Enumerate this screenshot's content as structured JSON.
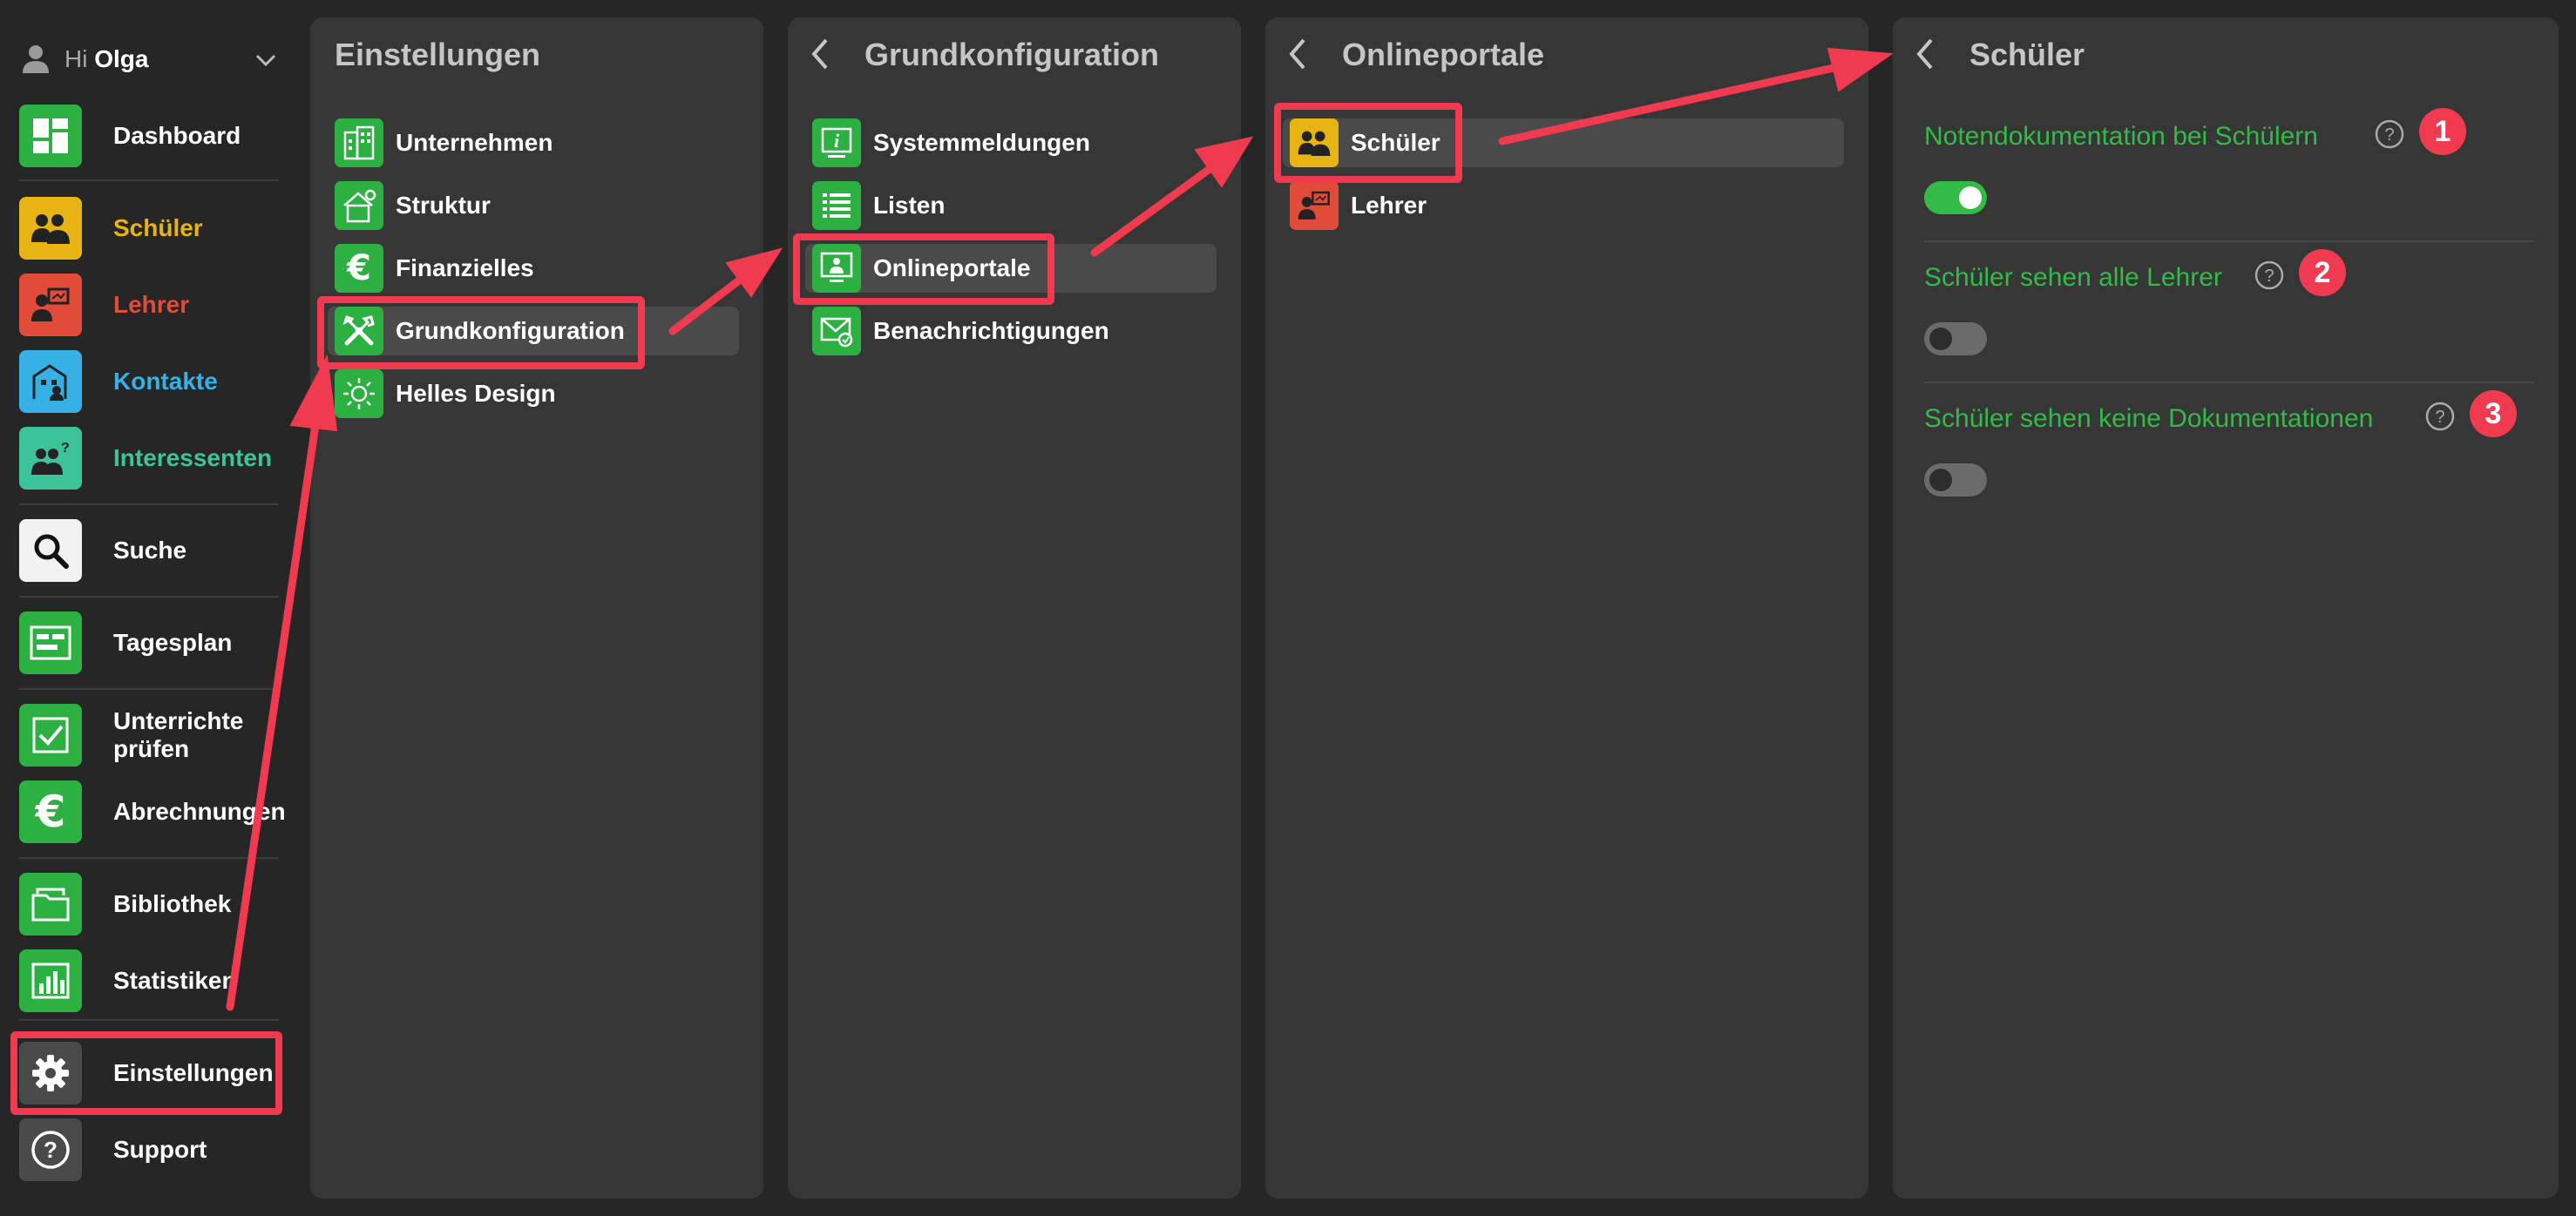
{
  "user": {
    "greeting": "Hi",
    "name": "Olga"
  },
  "sidebar": {
    "items": [
      {
        "label": "Dashboard",
        "color": "#ffffff",
        "icon": "dashboard-icon"
      },
      {
        "label": "Schüler",
        "color": "#e7b414",
        "icon": "students-icon"
      },
      {
        "label": "Lehrer",
        "color": "#e04b3a",
        "icon": "teacher-icon"
      },
      {
        "label": "Kontakte",
        "color": "#35b1e6",
        "icon": "contacts-icon"
      },
      {
        "label": "Interessenten",
        "color": "#3cc39a",
        "icon": "interested-icon"
      },
      {
        "label": "Suche",
        "color": "#ffffff",
        "icon": "search-icon"
      },
      {
        "label": "Tagesplan",
        "color": "#ffffff",
        "icon": "day-plan-icon"
      },
      {
        "label": "Unterrichte prüfen",
        "color": "#ffffff",
        "icon": "check-icon"
      },
      {
        "label": "Abrechnungen",
        "color": "#ffffff",
        "icon": "euro-icon"
      },
      {
        "label": "Bibliothek",
        "color": "#ffffff",
        "icon": "library-icon"
      },
      {
        "label": "Statistiken",
        "color": "#ffffff",
        "icon": "statistics-icon"
      },
      {
        "label": "Einstellungen",
        "color": "#ffffff",
        "icon": "gear-icon"
      },
      {
        "label": "Support",
        "color": "#ffffff",
        "icon": "help-icon"
      }
    ]
  },
  "panels": {
    "einstellungen": {
      "title": "Einstellungen",
      "items": [
        {
          "label": "Unternehmen",
          "icon": "building-icon"
        },
        {
          "label": "Struktur",
          "icon": "structure-icon"
        },
        {
          "label": "Finanzielles",
          "icon": "euro-icon"
        },
        {
          "label": "Grundkonfiguration",
          "icon": "tools-icon"
        },
        {
          "label": "Helles Design",
          "icon": "sun-icon"
        }
      ]
    },
    "grundkonfiguration": {
      "title": "Grundkonfiguration",
      "items": [
        {
          "label": "Systemmeldungen",
          "icon": "info-icon"
        },
        {
          "label": "Listen",
          "icon": "list-icon"
        },
        {
          "label": "Onlineportale",
          "icon": "portal-icon"
        },
        {
          "label": "Benachrichtigungen",
          "icon": "mail-icon"
        }
      ]
    },
    "onlineportale": {
      "title": "Onlineportale",
      "items": [
        {
          "label": "Schüler",
          "icon": "students-icon"
        },
        {
          "label": "Lehrer",
          "icon": "teacher-icon"
        }
      ]
    },
    "schueler": {
      "title": "Schüler",
      "settings": [
        {
          "label": "Notendokumentation bei Schülern",
          "badge": "1",
          "enabled": true
        },
        {
          "label": "Schüler sehen alle Lehrer",
          "badge": "2",
          "enabled": false
        },
        {
          "label": "Schüler sehen keine Dokumentationen",
          "badge": "3",
          "enabled": false
        }
      ]
    }
  },
  "colors": {
    "accent_green": "#33bb47",
    "annotation_red": "#ef3a50",
    "panel_bg": "#363636",
    "page_bg": "#262626"
  }
}
